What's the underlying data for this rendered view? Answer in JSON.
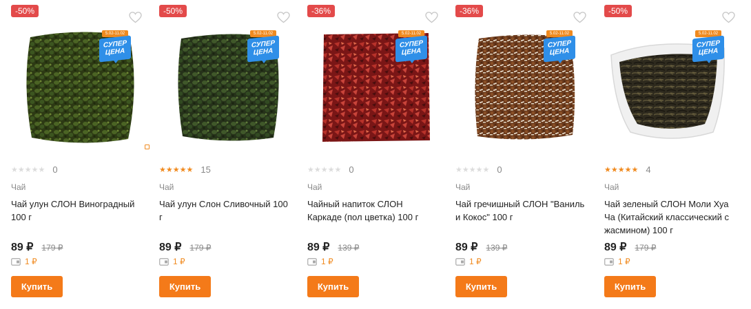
{
  "colors": {
    "accent": "#f47a19",
    "discount": "#e34a4a",
    "promo_blue": "#2f8fe8",
    "star_on": "#f08a1f",
    "star_off": "#dcdcdc",
    "muted": "#888888"
  },
  "products": [
    {
      "discount": "-50%",
      "promo_dates": "5.02-11.02",
      "promo_line1": "СУПЕР",
      "promo_line2": "ЦЕНА",
      "image_icon": "tea-oolong-image",
      "rating_stars": 0,
      "review_count": "0",
      "category": "Чай",
      "name": "Чай улун СЛОН Виноградный 100 г",
      "price": "89 ₽",
      "old_price": "179 ₽",
      "bonus": "1 ₽",
      "buy_label": "Купить"
    },
    {
      "discount": "-50%",
      "promo_dates": "5.02-11.02",
      "promo_line1": "СУПЕР",
      "promo_line2": "ЦЕНА",
      "image_icon": "tea-oolong-image",
      "rating_stars": 5,
      "review_count": "15",
      "category": "Чай",
      "name": "Чай улун Слон Сливочный 100 г",
      "price": "89 ₽",
      "old_price": "179 ₽",
      "bonus": "1 ₽",
      "buy_label": "Купить"
    },
    {
      "discount": "-36%",
      "promo_dates": "5.02-11.02",
      "promo_line1": "СУПЕР",
      "promo_line2": "ЦЕНА",
      "image_icon": "hibiscus-tea-image",
      "rating_stars": 0,
      "review_count": "0",
      "category": "Чай",
      "name": "Чайный напиток СЛОН Каркаде (пол цветка) 100 г",
      "price": "89 ₽",
      "old_price": "139 ₽",
      "bonus": "1 ₽",
      "buy_label": "Купить"
    },
    {
      "discount": "-36%",
      "promo_dates": "5.02-11.02",
      "promo_line1": "СУПЕР",
      "promo_line2": "ЦЕНА",
      "image_icon": "buckwheat-tea-image",
      "rating_stars": 0,
      "review_count": "0",
      "category": "Чай",
      "name": "Чай гречишный СЛОН \"Ваниль и Кокос\" 100 г",
      "price": "89 ₽",
      "old_price": "139 ₽",
      "bonus": "1 ₽",
      "buy_label": "Купить"
    },
    {
      "discount": "-50%",
      "promo_dates": "5.02-11.02",
      "promo_line1": "СУПЕР",
      "promo_line2": "ЦЕНА",
      "image_icon": "green-tea-bowl-image",
      "rating_stars": 5,
      "review_count": "4",
      "category": "Чай",
      "name": "Чай зеленый СЛОН Моли Хуа Ча (Китайский классический с жасмином) 100 г",
      "price": "89 ₽",
      "old_price": "179 ₽",
      "bonus": "1 ₽",
      "buy_label": "Купить"
    }
  ]
}
